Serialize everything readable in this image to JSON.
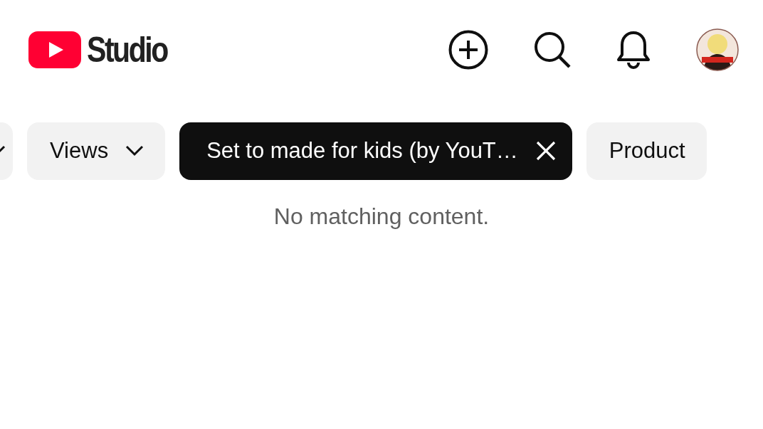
{
  "header": {
    "logo_text": "Studio"
  },
  "filters": [
    {
      "kind": "dropdown"
    },
    {
      "kind": "dropdown",
      "label": "Views"
    },
    {
      "kind": "applied",
      "label": "Set to made for kids (by YouT…"
    },
    {
      "kind": "plain",
      "label": "Product"
    }
  ],
  "empty_message": "No matching content."
}
